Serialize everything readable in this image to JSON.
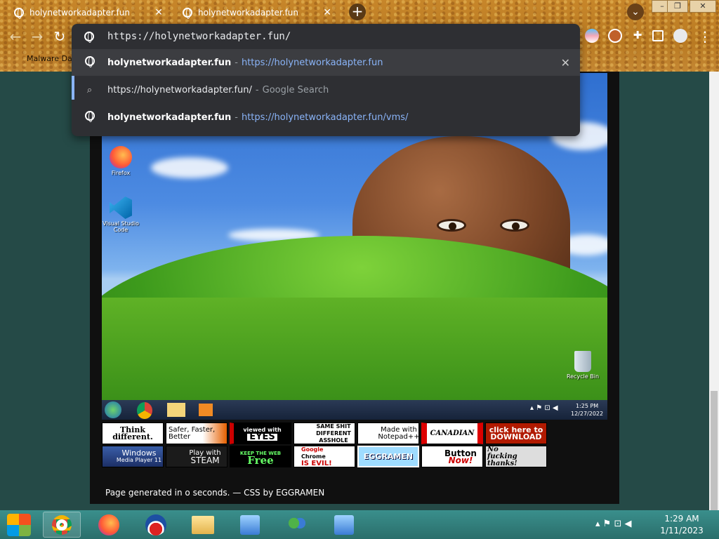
{
  "browser": {
    "tabs": [
      {
        "title": "holynetworkadapter.fun"
      },
      {
        "title": "holynetworkadapter.fun"
      }
    ],
    "bookmark": "Malware Dat",
    "omnibox": {
      "input_value": "https://holynetworkadapter.fun/",
      "suggestions": [
        {
          "bold": "holynetworkadapter.fun",
          "sep": "-",
          "url": "https://holynetworkadapter.fun",
          "suffix": ""
        },
        {
          "plain": "https://holynetworkadapter.fun/",
          "sep": "-",
          "hint": "Google Search"
        },
        {
          "bold": "holynetworkadapter.fun",
          "sep": "-",
          "url": "https://holynetworkadapter.fun",
          "suffix": "/vms/"
        }
      ]
    }
  },
  "desktop": {
    "icons": [
      {
        "label": "Firefox"
      },
      {
        "label": "Visual Studio Code"
      },
      {
        "label": "Recycle Bin"
      }
    ],
    "clock": {
      "time": "1:25 PM",
      "date": "12/27/2022"
    }
  },
  "badges": {
    "row1": [
      {
        "id": "apple",
        "top": "Think",
        "bottom": "different."
      },
      {
        "id": "firefox",
        "top": "Safer, Faster,",
        "bottom": "Better"
      },
      {
        "id": "eyes",
        "top": "viewed with",
        "bottom": "EYES"
      },
      {
        "id": "ie",
        "top": "SAME SHIT",
        "mid": "DIFFERENT",
        "bottom": "ASSHOLE"
      },
      {
        "id": "notepad",
        "top": "Made with",
        "bottom": "Notepad++"
      },
      {
        "id": "canadian",
        "top": "CANADIAN"
      },
      {
        "id": "download",
        "top": "click here to",
        "bottom": "DOWNLOAD"
      }
    ],
    "row2": [
      {
        "id": "wmp",
        "top": "Windows",
        "bottom": "Media Player 11"
      },
      {
        "id": "steam",
        "top": "Play with",
        "bottom": "STEAM"
      },
      {
        "id": "free",
        "top": "KEEP THE WEB",
        "bottom": "Free"
      },
      {
        "id": "chrome",
        "top": "Google",
        "mid": "Chrome",
        "bottom": "IS EVIL!"
      },
      {
        "id": "eggramen",
        "top": "EGGRAMEN"
      },
      {
        "id": "buttonnow",
        "top": "Button",
        "bottom": "Now!"
      },
      {
        "id": "bonk",
        "top": "No",
        "mid": "fucking",
        "bottom": "thanks!"
      }
    ]
  },
  "footer": "Page generated in o seconds. — CSS by EGGRAMEN",
  "system": {
    "time": "1:29 AM",
    "date": "1/11/2023"
  }
}
